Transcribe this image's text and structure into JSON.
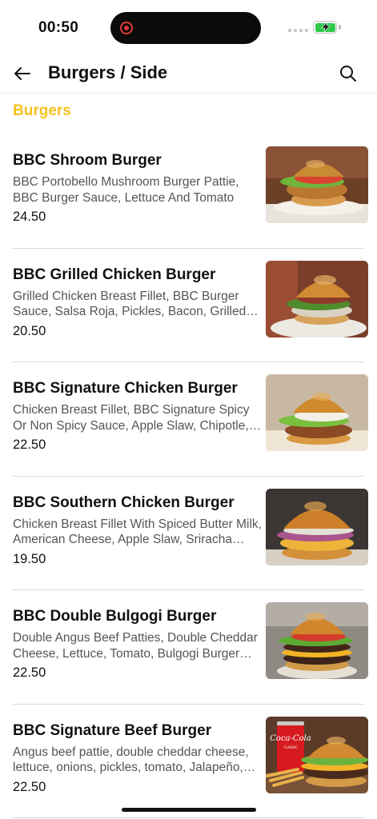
{
  "status_bar": {
    "time": "00:50",
    "battery_color": "#2ec94b",
    "recording_color": "#e23b3b"
  },
  "header": {
    "back_icon": "arrow-left-icon",
    "title": "Burgers / Side",
    "search_icon": "search-icon"
  },
  "section": {
    "title": "Burgers",
    "accent_color": "#f4c21f"
  },
  "items": [
    {
      "name": "BBC Shroom Burger",
      "description": "BBC Portobello Mushroom Burger Pattie, BBC Burger Sauce, Lettuce And Tomato",
      "price": "24.50",
      "image": "burger-photo"
    },
    {
      "name": "BBC Grilled Chicken Burger",
      "description": "Grilled Chicken Breast Fillet, BBC Burger Sauce, Salsa Roja, Pickles, Bacon, Grilled Pineapple",
      "price": "20.50",
      "image": "burger-photo"
    },
    {
      "name": "BBC Signature Chicken Burger",
      "description": "Chicken Breast Fillet, BBC Signature Spicy Or Non Spicy Sauce, Apple Slaw, Chipotle, Pickles",
      "price": "22.50",
      "image": "burger-photo"
    },
    {
      "name": "BBC Southern Chicken Burger",
      "description": "Chicken Breast Fillet With Spiced Butter Milk, American Cheese, Apple Slaw, Sriracha Mayo",
      "price": "19.50",
      "image": "burger-photo"
    },
    {
      "name": "BBC Double Bulgogi Burger",
      "description": "Double Angus Beef Patties, Double Cheddar Cheese, Lettuce, Tomato, Bulgogi Burger Sauce",
      "price": "22.50",
      "image": "burger-photo"
    },
    {
      "name": "BBC Signature Beef Burger",
      "description": "Angus beef pattie, double cheddar cheese, lettuce, onions, pickles, tomato, Jalapeño, BBC sauce",
      "price": "22.50",
      "image": "burger-with-cola-photo",
      "can_brand": "Coca-Cola",
      "can_label": "CLASSIC"
    }
  ]
}
